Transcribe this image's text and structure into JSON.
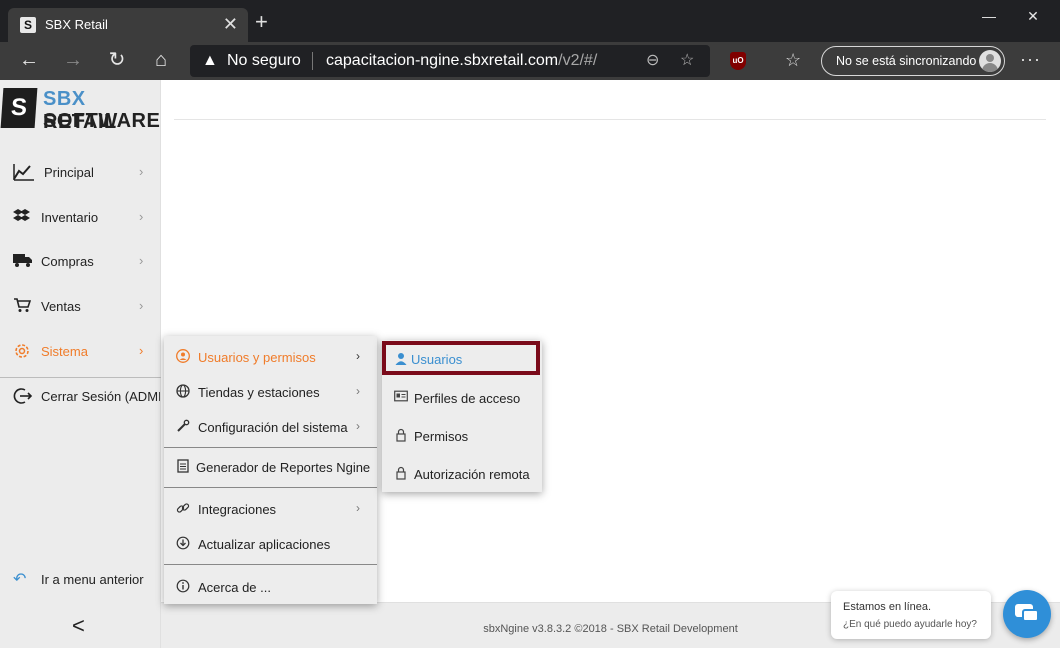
{
  "browser": {
    "tab_title": "SBX Retail",
    "tab_favicon": "S",
    "tab_close": "✕",
    "new_tab": "+",
    "window_controls": {
      "minimize": "—",
      "maximize": "☐",
      "close": "✕"
    },
    "security_label": "No seguro",
    "url_host": "capacitacion-ngine.sbxretail.com",
    "url_path": "/v2/#/",
    "sync_label": "No se está sincronizando",
    "more": "···",
    "icons": {
      "back": "back-arrow-icon",
      "forward": "forward-arrow-icon",
      "refresh": "refresh-icon",
      "home": "home-icon",
      "warning": "warning-icon",
      "zoom": "zoom-icon",
      "favorite": "add-favorite-icon",
      "ublock": "ublock-icon",
      "collections": "favorites-list-icon",
      "profile": "profile-icon"
    }
  },
  "logo": {
    "line1_part1": "SBX",
    "line1_part2": " RETAIL",
    "line2": "SOFTWARE",
    "mark": "S"
  },
  "sidebar": {
    "items": [
      {
        "label": "Principal",
        "icon": "chart-line-icon"
      },
      {
        "label": "Inventario",
        "icon": "dropbox-icon"
      },
      {
        "label": "Compras",
        "icon": "truck-icon"
      },
      {
        "label": "Ventas",
        "icon": "cart-icon"
      },
      {
        "label": "Sistema",
        "icon": "gear-icon"
      },
      {
        "label": "Cerrar Sesión (ADMIN)",
        "icon": "logout-icon"
      }
    ],
    "chevron": "›",
    "back_menu_label": "Ir a menu anterior",
    "collapse": "<"
  },
  "menu1": {
    "items": [
      {
        "label": "Usuarios y permisos",
        "icon": "user-circle-icon"
      },
      {
        "label": "Tiendas y estaciones",
        "icon": "globe-icon"
      },
      {
        "label": "Configuración del sistema",
        "icon": "wrench-icon"
      },
      {
        "label": "Generador de Reportes Ngine",
        "icon": "report-icon"
      },
      {
        "label": "Integraciones",
        "icon": "link-icon"
      },
      {
        "label": "Actualizar aplicaciones",
        "icon": "download-circle-icon"
      },
      {
        "label": "Acerca de ...",
        "icon": "info-icon"
      }
    ],
    "chevron": "›"
  },
  "menu2": {
    "items": [
      {
        "label": "Usuarios",
        "icon": "user-icon"
      },
      {
        "label": "Perfiles de acceso",
        "icon": "id-card-icon"
      },
      {
        "label": "Permisos",
        "icon": "lock-icon"
      },
      {
        "label": "Autorización remota",
        "icon": "lock-icon"
      }
    ]
  },
  "footer": {
    "text": "sbxNgine v3.8.3.2 ©2018 - SBX Retail Development"
  },
  "chat": {
    "title": "Estamos en línea.",
    "subtitle": "¿En qué puedo ayudarle hoy?"
  },
  "colors": {
    "accent": "#f07c2a",
    "link_blue": "#3a8fd0",
    "highlight_border": "#7a0a1a",
    "chat_blue": "#2f8fd8"
  }
}
